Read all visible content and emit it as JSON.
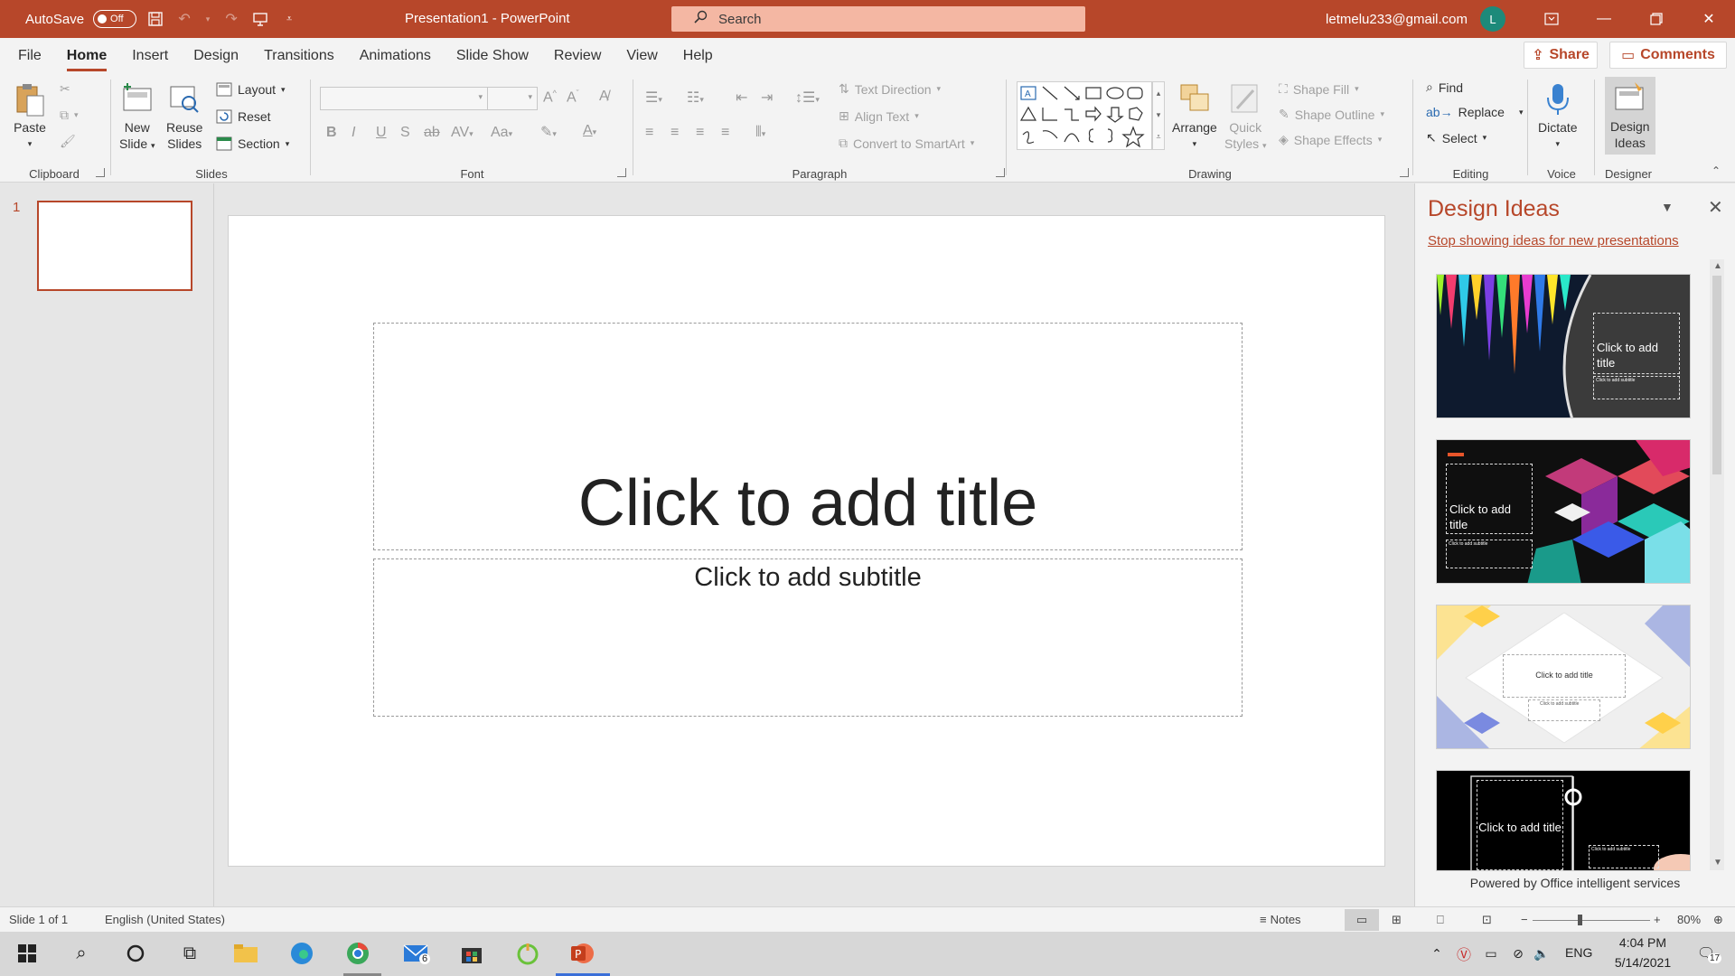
{
  "titlebar": {
    "autosave_label": "AutoSave",
    "autosave_state": "Off",
    "doc_title": "Presentation1  -  PowerPoint",
    "search_placeholder": "Search",
    "user_email": "letmelu233@gmail.com",
    "avatar_initial": "L"
  },
  "tabs": [
    {
      "label": "File",
      "active": false
    },
    {
      "label": "Home",
      "active": true
    },
    {
      "label": "Insert",
      "active": false
    },
    {
      "label": "Design",
      "active": false
    },
    {
      "label": "Transitions",
      "active": false
    },
    {
      "label": "Animations",
      "active": false
    },
    {
      "label": "Slide Show",
      "active": false
    },
    {
      "label": "Review",
      "active": false
    },
    {
      "label": "View",
      "active": false
    },
    {
      "label": "Help",
      "active": false
    }
  ],
  "actions": {
    "share": "Share",
    "comments": "Comments"
  },
  "ribbon": {
    "clipboard": {
      "label": "Clipboard",
      "paste": "Paste"
    },
    "slides": {
      "label": "Slides",
      "new_slide_1": "New",
      "new_slide_2": "Slide",
      "reuse_1": "Reuse",
      "reuse_2": "Slides",
      "layout": "Layout",
      "reset": "Reset",
      "section": "Section"
    },
    "font": {
      "label": "Font"
    },
    "paragraph": {
      "label": "Paragraph",
      "text_direction": "Text Direction",
      "align_text": "Align Text",
      "convert_smartart": "Convert to SmartArt"
    },
    "drawing": {
      "label": "Drawing",
      "arrange": "Arrange",
      "quick_styles_1": "Quick",
      "quick_styles_2": "Styles",
      "shape_fill": "Shape Fill",
      "shape_outline": "Shape Outline",
      "shape_effects": "Shape Effects"
    },
    "editing": {
      "label": "Editing",
      "find": "Find",
      "replace": "Replace",
      "select": "Select"
    },
    "voice": {
      "label": "Voice",
      "dictate": "Dictate"
    },
    "designer": {
      "label": "Designer",
      "design_ideas_1": "Design",
      "design_ideas_2": "Ideas"
    }
  },
  "thumbs": {
    "slide_number": "1"
  },
  "slide": {
    "title_placeholder": "Click to add title",
    "subtitle_placeholder": "Click to add subtitle"
  },
  "design_pane": {
    "title": "Design Ideas",
    "stop_link": "Stop showing ideas for new presentations",
    "idea_titles": [
      "Click to add title",
      "Click to add title",
      "Click to add title",
      "Click to add title"
    ],
    "idea_subtitle": "Click to add subtitle",
    "powered": "Powered by Office intelligent services"
  },
  "status": {
    "slide_count": "Slide 1 of 1",
    "language": "English (United States)",
    "notes": "Notes",
    "zoom": "80%",
    "zoom_level": 0.4
  },
  "taskbar": {
    "mail_badge": "6",
    "lang": "ENG",
    "time": "4:04 PM",
    "date": "5/14/2021",
    "notif_count": "17"
  },
  "colors": {
    "accent": "#b7472a",
    "search_bg": "#f4b7a3"
  }
}
